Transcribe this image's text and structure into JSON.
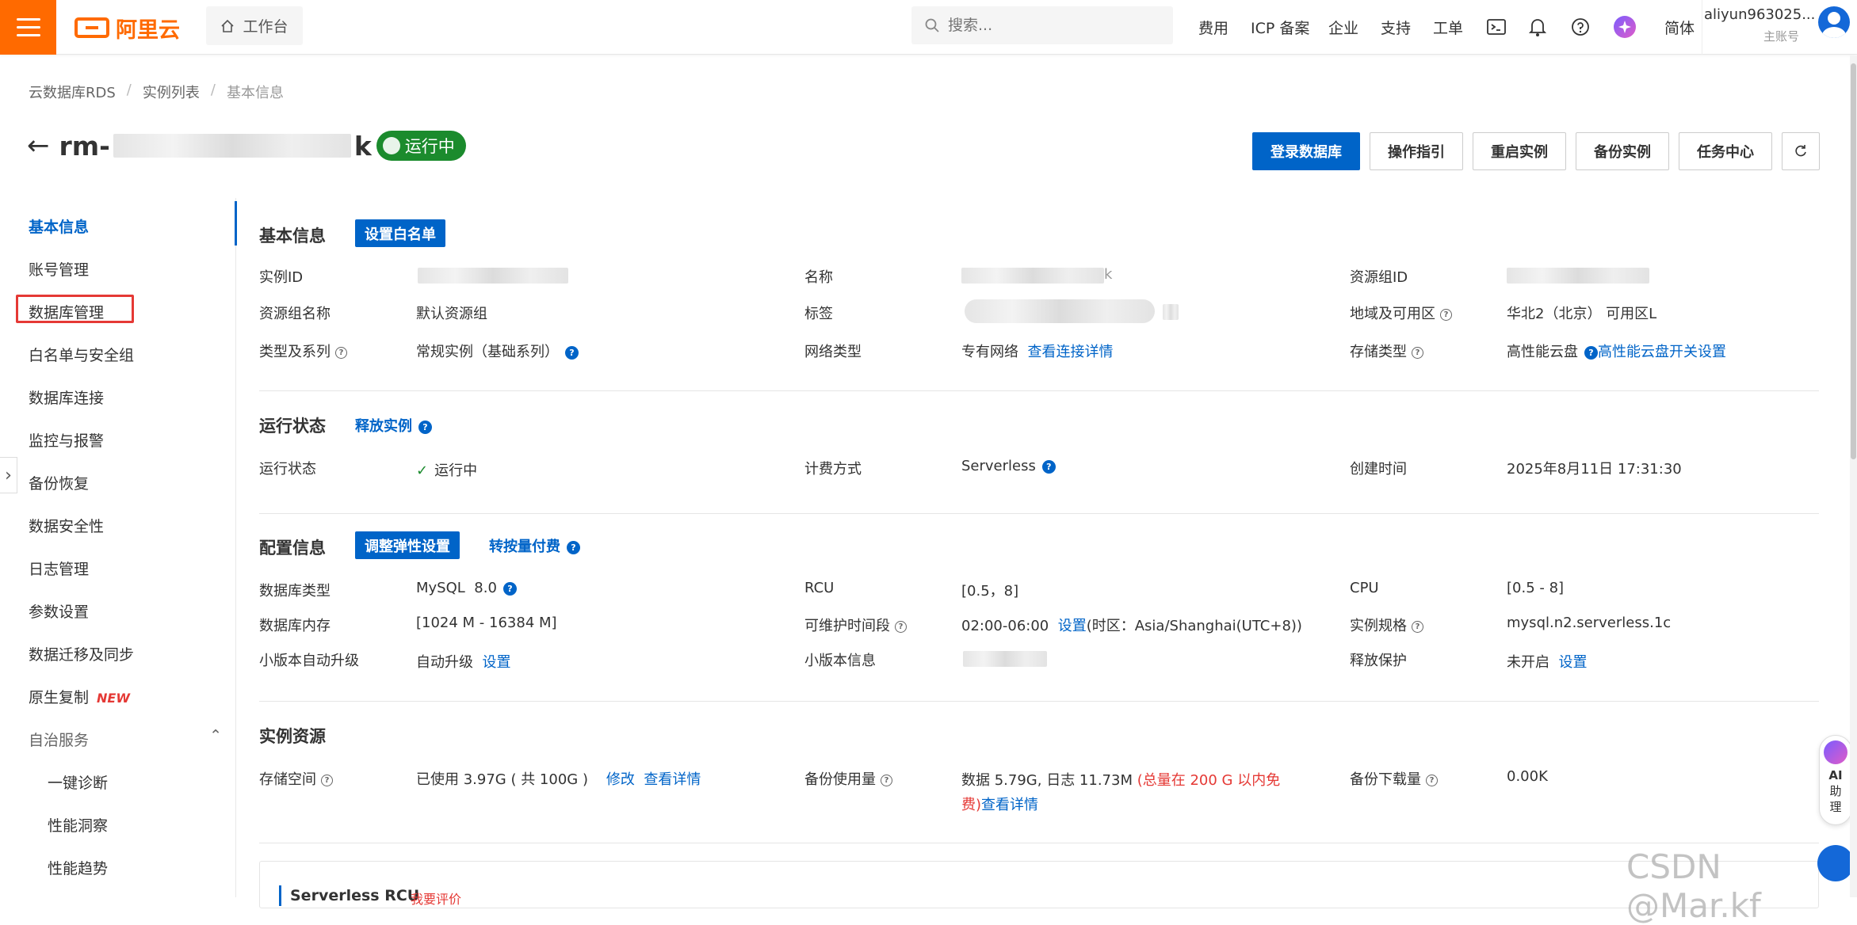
{
  "topbar": {
    "logo": "阿里云",
    "workbench": "工作台",
    "search_placeholder": "搜索...",
    "nav": [
      "费用",
      "ICP 备案",
      "企业",
      "支持",
      "工单"
    ],
    "lang": "简体",
    "user_name": "aliyun963025...",
    "user_role": "主账号"
  },
  "breadcrumb": [
    "云数据库RDS",
    "实例列表",
    "基本信息"
  ],
  "instance": {
    "id_prefix": "rm-",
    "id_suffix": "k",
    "status": "运行中"
  },
  "actions": [
    "登录数据库",
    "操作指引",
    "重启实例",
    "备份实例",
    "任务中心"
  ],
  "sidebar": {
    "items": [
      "基本信息",
      "账号管理",
      "数据库管理",
      "白名单与安全组",
      "数据库连接",
      "监控与报警",
      "备份恢复",
      "数据安全性",
      "日志管理",
      "参数设置",
      "数据迁移及同步",
      "原生复制"
    ],
    "new_tag": "NEW",
    "group": "自治服务",
    "sub_items": [
      "一键诊断",
      "性能洞察",
      "性能趋势"
    ]
  },
  "basic": {
    "title": "基本信息",
    "whitelist_btn": "设置白名单",
    "labels": [
      "实例ID",
      "名称",
      "资源组ID",
      "资源组名称",
      "标签",
      "地域及可用区",
      "类型及系列",
      "网络类型",
      "存储类型"
    ],
    "resource_group": "默认资源组",
    "name_tail": "k",
    "region": "华北2（北京） 可用区L",
    "type_series": "常规实例（基础系列）",
    "network": "专有网络",
    "network_link": "查看连接详情",
    "storage": "高性能云盘",
    "storage_link": "高性能云盘开关设置"
  },
  "run": {
    "title": "运行状态",
    "release_link": "释放实例",
    "status_label": "运行状态",
    "status_value": "运行中",
    "billing_label": "计费方式",
    "billing_value": "Serverless",
    "created_label": "创建时间",
    "created_value": "2025年8月11日 17:31:30"
  },
  "config": {
    "title": "配置信息",
    "scale_btn": "调整弹性设置",
    "payg_link": "转按量付费",
    "db_type_label": "数据库类型",
    "db_type": "MySQL",
    "db_version": "8.0",
    "rcu_label": "RCU",
    "rcu": "[0.5，8]",
    "cpu_label": "CPU",
    "cpu": "[0.5 - 8]",
    "mem_label": "数据库内存",
    "mem": "[1024 M - 16384 M]",
    "maint_label": "可维护时间段",
    "maint_time": "02:00-06:00",
    "maint_set": "设置",
    "maint_tz": "(时区：Asia/Shanghai(UTC+8))",
    "spec_label": "实例规格",
    "spec": "mysql.n2.serverless.1c",
    "minor_label": "小版本自动升级",
    "minor_value": "自动升级",
    "minor_set": "设置",
    "minor_info_label": "小版本信息",
    "protect_label": "释放保护",
    "protect_value": "未开启",
    "protect_set": "设置"
  },
  "resources": {
    "title": "实例资源",
    "storage_label": "存储空间",
    "storage_value": "已使用 3.97G ( 共 100G )",
    "storage_edit": "修改",
    "storage_detail": "查看详情",
    "backup_label": "备份使用量",
    "backup_value": "数据 5.79G, 日志 11.73M",
    "backup_note_a": "(总量在 200 G 以内免",
    "backup_note_b": "费)",
    "backup_detail": "查看详情",
    "download_label": "备份下载量",
    "download_value": "0.00K"
  },
  "panel": {
    "title": "Serverless RCU",
    "rating": "我要评价"
  },
  "float": {
    "ai": "AI",
    "ai_2": "助",
    "ai_3": "理"
  },
  "watermark": "CSDN @Mar.kf"
}
